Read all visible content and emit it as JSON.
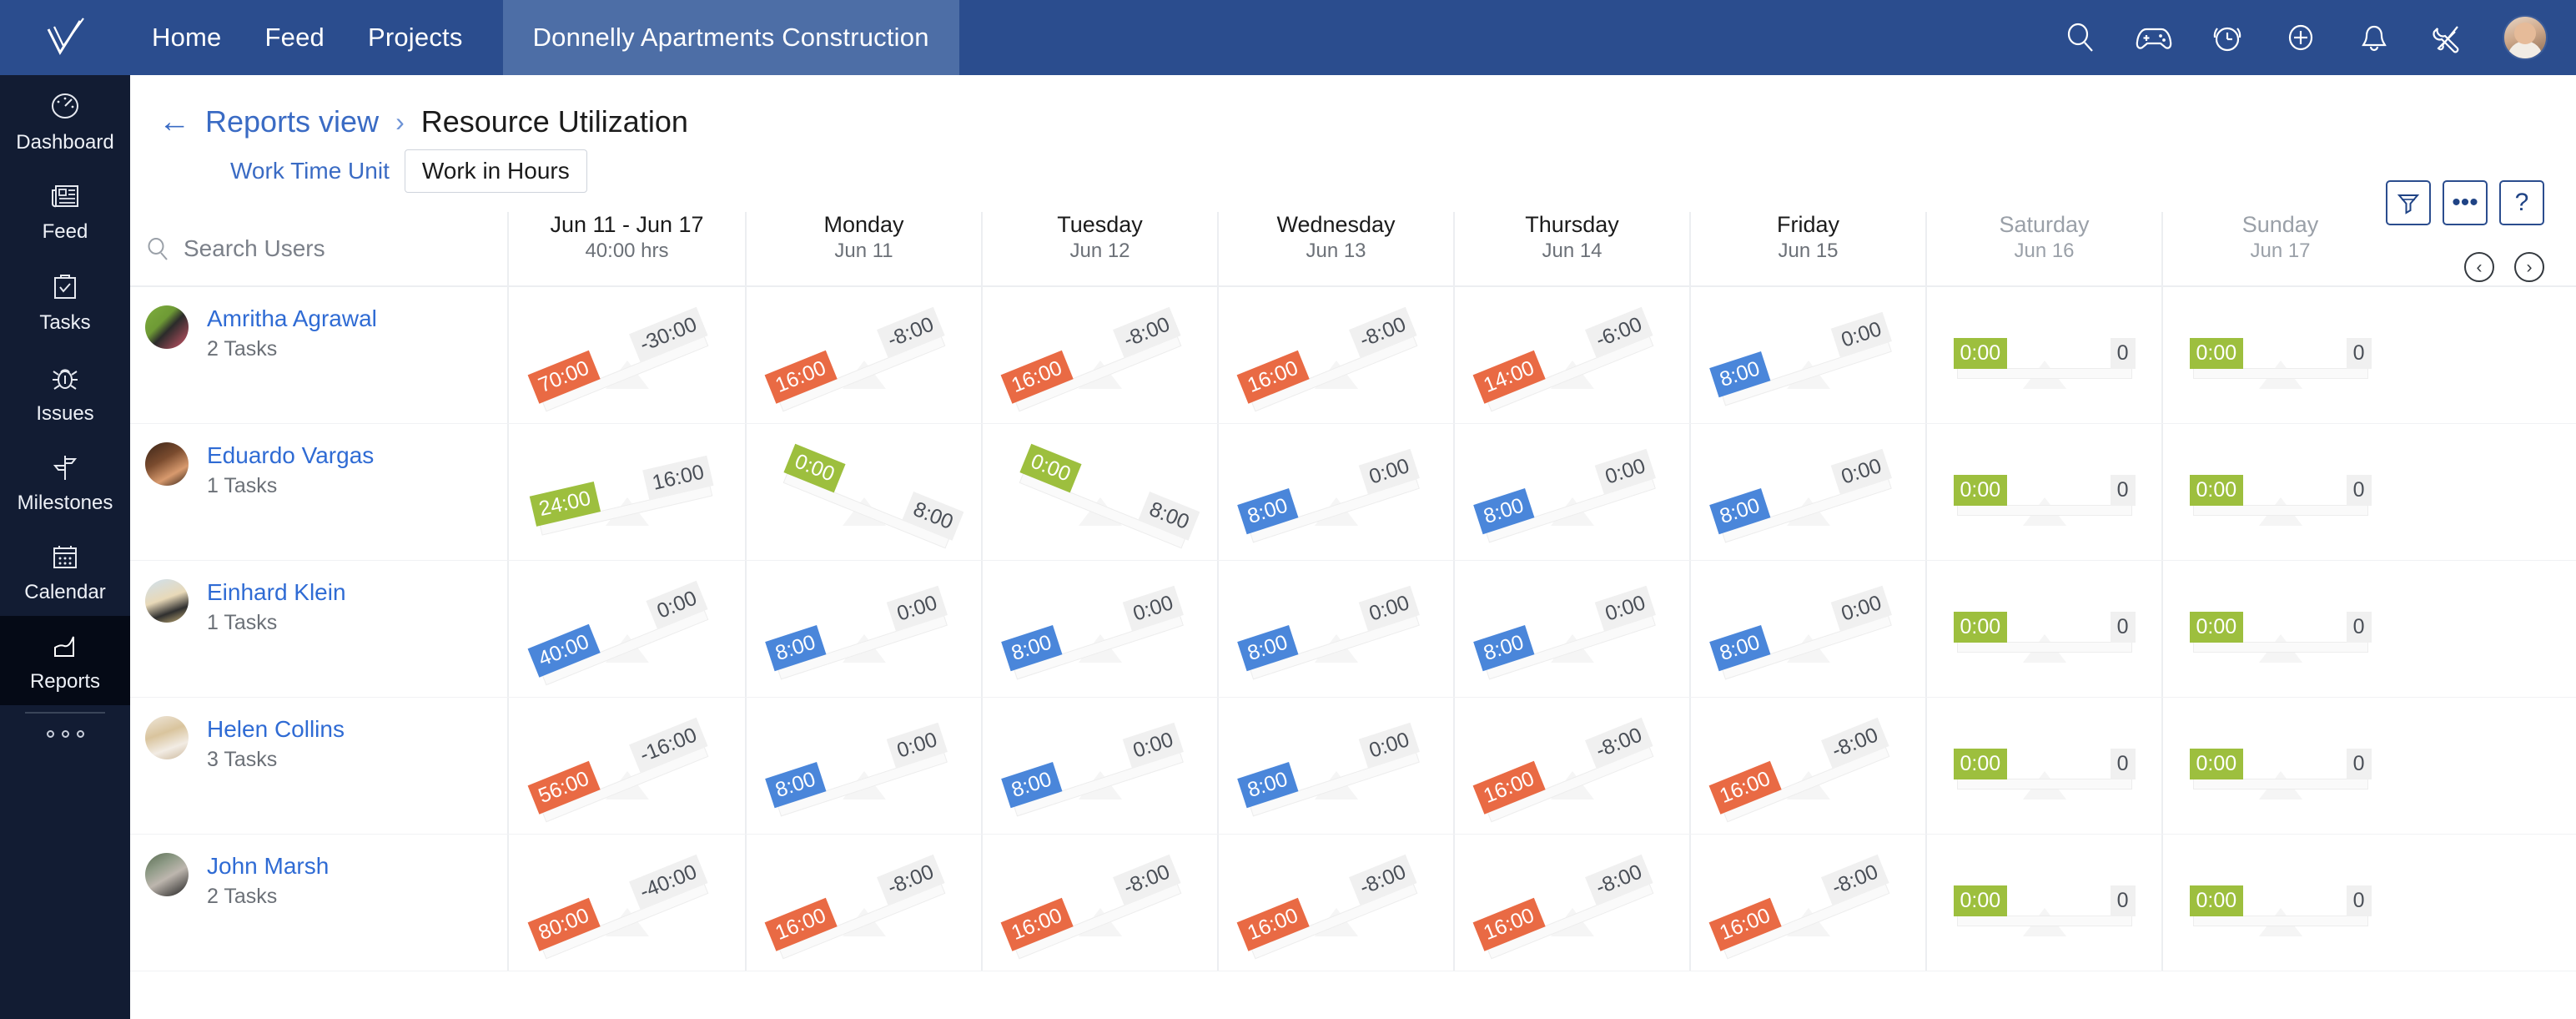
{
  "topbar": {
    "logo_icon": "checkmark-logo-icon",
    "nav": [
      {
        "label": "Home",
        "id": "home"
      },
      {
        "label": "Feed",
        "id": "feed"
      },
      {
        "label": "Projects",
        "id": "projects"
      }
    ],
    "project": "Donnelly Apartments Construction",
    "icons": [
      "search-icon",
      "gamepad-icon",
      "timer-icon",
      "plus-circle-icon",
      "bell-icon",
      "tools-icon"
    ],
    "avatar": "user-avatar"
  },
  "sidebar": {
    "items": [
      {
        "label": "Dashboard",
        "icon": "speedometer-icon",
        "active": false
      },
      {
        "label": "Feed",
        "icon": "newspaper-icon",
        "active": false
      },
      {
        "label": "Tasks",
        "icon": "clipboard-check-icon",
        "active": false
      },
      {
        "label": "Issues",
        "icon": "bug-icon",
        "active": false
      },
      {
        "label": "Milestones",
        "icon": "signpost-icon",
        "active": false
      },
      {
        "label": "Calendar",
        "icon": "calendar-icon",
        "active": false
      },
      {
        "label": "Reports",
        "icon": "area-chart-icon",
        "active": true
      }
    ],
    "more_icon": "more-horizontal-icon"
  },
  "header": {
    "back_icon": "arrow-left-icon",
    "breadcrumb_link": "Reports view",
    "breadcrumb_sep": "›",
    "title": "Resource Utilization",
    "actions": [
      {
        "id": "filter",
        "icon": "filter-icon",
        "glyph": ""
      },
      {
        "id": "more",
        "icon": "more-icon",
        "glyph": "•••"
      },
      {
        "id": "help",
        "icon": "question-icon",
        "glyph": "?"
      }
    ],
    "pager": [
      {
        "id": "prev",
        "icon": "chevron-left-icon",
        "glyph": "‹"
      },
      {
        "id": "next",
        "icon": "chevron-right-icon",
        "glyph": "›"
      }
    ]
  },
  "subheader": {
    "work_time_unit_label": "Work Time Unit",
    "work_time_unit_value": "Work in Hours"
  },
  "search": {
    "placeholder": "Search Users",
    "value": "",
    "icon": "search-icon"
  },
  "columns": [
    {
      "id": "total",
      "name": "Jun 11 - Jun 17",
      "sub": "40:00 hrs",
      "muted": false,
      "is_total": true
    },
    {
      "id": "monday",
      "name": "Monday",
      "sub": "Jun 11",
      "muted": false,
      "is_total": false
    },
    {
      "id": "tuesday",
      "name": "Tuesday",
      "sub": "Jun 12",
      "muted": false,
      "is_total": false
    },
    {
      "id": "wednesday",
      "name": "Wednesday",
      "sub": "Jun 13",
      "muted": false,
      "is_total": false
    },
    {
      "id": "thursday",
      "name": "Thursday",
      "sub": "Jun 14",
      "muted": false,
      "is_total": false
    },
    {
      "id": "friday",
      "name": "Friday",
      "sub": "Jun 15",
      "muted": false,
      "is_total": false
    },
    {
      "id": "saturday",
      "name": "Saturday",
      "sub": "Jun 16",
      "muted": true,
      "is_total": false
    },
    {
      "id": "sunday",
      "name": "Sunday",
      "sub": "Jun 17",
      "muted": true,
      "is_total": false
    }
  ],
  "colors": {
    "brand_blue": "#2b4d8e",
    "sidebar": "#121c33",
    "link": "#2f6bd4",
    "over_allocated": "#e96a44",
    "under_allocated": "#9dbf3e",
    "exact_allocated": "#4a86da",
    "remaining_bg": "#f0f0f0"
  },
  "rows": [
    {
      "name": "Amritha Agrawal",
      "tasks": "2 Tasks",
      "avatar": "avatar-amritha",
      "cells": [
        {
          "alloc": "70:00",
          "rem": "-30:00",
          "state": "over",
          "tilt": -22
        },
        {
          "alloc": "16:00",
          "rem": "-8:00",
          "state": "over",
          "tilt": -22
        },
        {
          "alloc": "16:00",
          "rem": "-8:00",
          "state": "over",
          "tilt": -22
        },
        {
          "alloc": "16:00",
          "rem": "-8:00",
          "state": "over",
          "tilt": -22
        },
        {
          "alloc": "14:00",
          "rem": "-6:00",
          "state": "over",
          "tilt": -22
        },
        {
          "alloc": "8:00",
          "rem": "0:00",
          "state": "exact",
          "tilt": -18
        },
        {
          "alloc": "0:00",
          "rem": "0",
          "state": "under",
          "tilt": 0
        },
        {
          "alloc": "0:00",
          "rem": "0",
          "state": "under",
          "tilt": 0
        }
      ]
    },
    {
      "name": "Eduardo Vargas",
      "tasks": "1 Tasks",
      "avatar": "avatar-eduardo",
      "cells": [
        {
          "alloc": "24:00",
          "rem": "16:00",
          "state": "under",
          "tilt": -13
        },
        {
          "alloc": "0:00",
          "rem": "8:00",
          "state": "under",
          "tilt": 22
        },
        {
          "alloc": "0:00",
          "rem": "8:00",
          "state": "under",
          "tilt": 22
        },
        {
          "alloc": "8:00",
          "rem": "0:00",
          "state": "exact",
          "tilt": -18
        },
        {
          "alloc": "8:00",
          "rem": "0:00",
          "state": "exact",
          "tilt": -18
        },
        {
          "alloc": "8:00",
          "rem": "0:00",
          "state": "exact",
          "tilt": -18
        },
        {
          "alloc": "0:00",
          "rem": "0",
          "state": "under",
          "tilt": 0
        },
        {
          "alloc": "0:00",
          "rem": "0",
          "state": "under",
          "tilt": 0
        }
      ]
    },
    {
      "name": "Einhard Klein",
      "tasks": "1 Tasks",
      "avatar": "avatar-einhard",
      "cells": [
        {
          "alloc": "40:00",
          "rem": "0:00",
          "state": "exact",
          "tilt": -22
        },
        {
          "alloc": "8:00",
          "rem": "0:00",
          "state": "exact",
          "tilt": -18
        },
        {
          "alloc": "8:00",
          "rem": "0:00",
          "state": "exact",
          "tilt": -18
        },
        {
          "alloc": "8:00",
          "rem": "0:00",
          "state": "exact",
          "tilt": -18
        },
        {
          "alloc": "8:00",
          "rem": "0:00",
          "state": "exact",
          "tilt": -18
        },
        {
          "alloc": "8:00",
          "rem": "0:00",
          "state": "exact",
          "tilt": -18
        },
        {
          "alloc": "0:00",
          "rem": "0",
          "state": "under",
          "tilt": 0
        },
        {
          "alloc": "0:00",
          "rem": "0",
          "state": "under",
          "tilt": 0
        }
      ]
    },
    {
      "name": "Helen Collins",
      "tasks": "3 Tasks",
      "avatar": "avatar-helen",
      "cells": [
        {
          "alloc": "56:00",
          "rem": "-16:00",
          "state": "over",
          "tilt": -22
        },
        {
          "alloc": "8:00",
          "rem": "0:00",
          "state": "exact",
          "tilt": -18
        },
        {
          "alloc": "8:00",
          "rem": "0:00",
          "state": "exact",
          "tilt": -18
        },
        {
          "alloc": "8:00",
          "rem": "0:00",
          "state": "exact",
          "tilt": -18
        },
        {
          "alloc": "16:00",
          "rem": "-8:00",
          "state": "over",
          "tilt": -22
        },
        {
          "alloc": "16:00",
          "rem": "-8:00",
          "state": "over",
          "tilt": -22
        },
        {
          "alloc": "0:00",
          "rem": "0",
          "state": "under",
          "tilt": 0
        },
        {
          "alloc": "0:00",
          "rem": "0",
          "state": "under",
          "tilt": 0
        }
      ]
    },
    {
      "name": "John Marsh",
      "tasks": "2 Tasks",
      "avatar": "avatar-john",
      "cells": [
        {
          "alloc": "80:00",
          "rem": "-40:00",
          "state": "over",
          "tilt": -22
        },
        {
          "alloc": "16:00",
          "rem": "-8:00",
          "state": "over",
          "tilt": -22
        },
        {
          "alloc": "16:00",
          "rem": "-8:00",
          "state": "over",
          "tilt": -22
        },
        {
          "alloc": "16:00",
          "rem": "-8:00",
          "state": "over",
          "tilt": -22
        },
        {
          "alloc": "16:00",
          "rem": "-8:00",
          "state": "over",
          "tilt": -22
        },
        {
          "alloc": "16:00",
          "rem": "-8:00",
          "state": "over",
          "tilt": -22
        },
        {
          "alloc": "0:00",
          "rem": "0",
          "state": "under",
          "tilt": 0
        },
        {
          "alloc": "0:00",
          "rem": "0",
          "state": "under",
          "tilt": 0
        }
      ]
    }
  ]
}
